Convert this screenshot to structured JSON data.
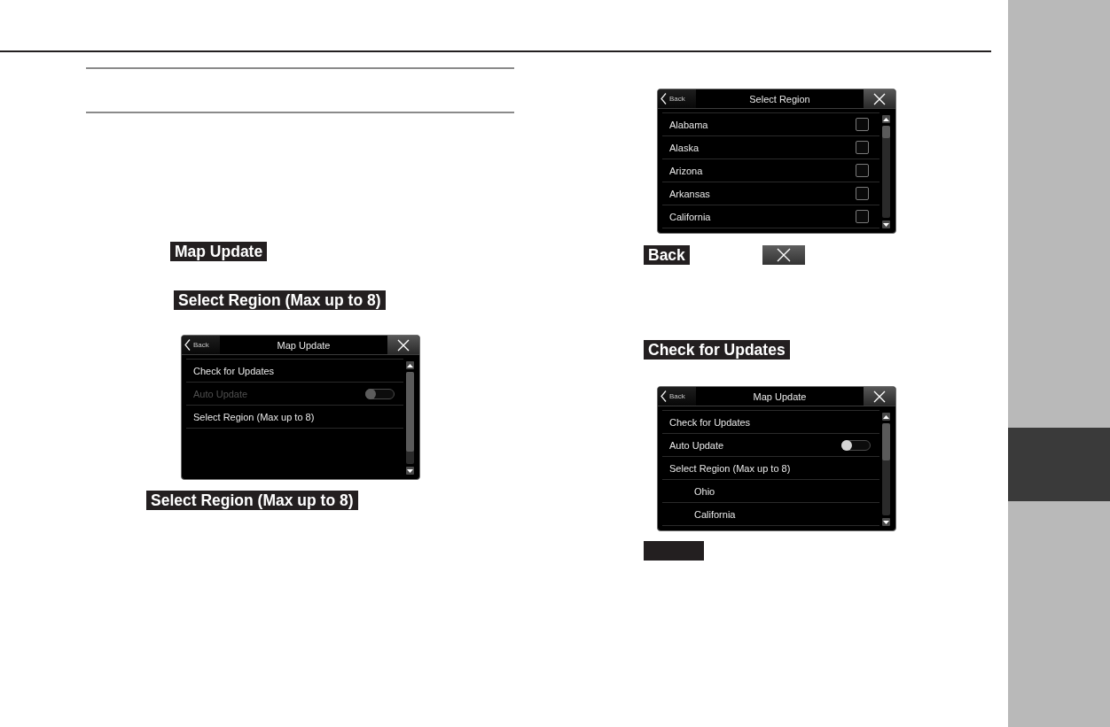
{
  "left_column": {
    "blocks": [
      {
        "kind": "label",
        "text": "Map Update"
      },
      {
        "kind": "label",
        "text": "Select Region (Max up to 8)"
      },
      {
        "kind": "screen",
        "back_label": "Back",
        "title": "Map Update",
        "rows": [
          {
            "kind": "item",
            "label": "Check for Updates",
            "disabled": false
          },
          {
            "kind": "toggle",
            "label": "Auto Update",
            "on": false,
            "disabled": true
          },
          {
            "kind": "item",
            "label": "Select Region (Max up to 8)",
            "disabled": false
          }
        ]
      },
      {
        "kind": "label",
        "text": "Select Region (Max up to 8)"
      }
    ]
  },
  "right_column": {
    "blocks": [
      {
        "kind": "screen",
        "back_label": "Back",
        "title": "Select Region",
        "rows": [
          {
            "kind": "checkbox",
            "label": "Alabama",
            "checked": false
          },
          {
            "kind": "checkbox",
            "label": "Alaska",
            "checked": false
          },
          {
            "kind": "checkbox",
            "label": "Arizona",
            "checked": false
          },
          {
            "kind": "checkbox",
            "label": "Arkansas",
            "checked": false
          },
          {
            "kind": "checkbox",
            "label": "California",
            "checked": false
          }
        ]
      },
      {
        "kind": "row",
        "items": [
          {
            "kind": "label",
            "text": "Back"
          },
          {
            "kind": "close_label"
          }
        ]
      },
      {
        "kind": "label",
        "text": "Check for Updates"
      },
      {
        "kind": "screen",
        "back_label": "Back",
        "title": "Map Update",
        "rows": [
          {
            "kind": "item",
            "label": "Check for Updates",
            "disabled": false
          },
          {
            "kind": "toggle",
            "label": "Auto Update",
            "on": false,
            "disabled": false
          },
          {
            "kind": "item",
            "label": "Select Region (Max up to 8)",
            "disabled": false
          },
          {
            "kind": "sub_item",
            "label": "Ohio",
            "disabled": false
          },
          {
            "kind": "sub_item",
            "label": "California",
            "disabled": false
          }
        ]
      },
      {
        "kind": "blank_label"
      }
    ]
  }
}
